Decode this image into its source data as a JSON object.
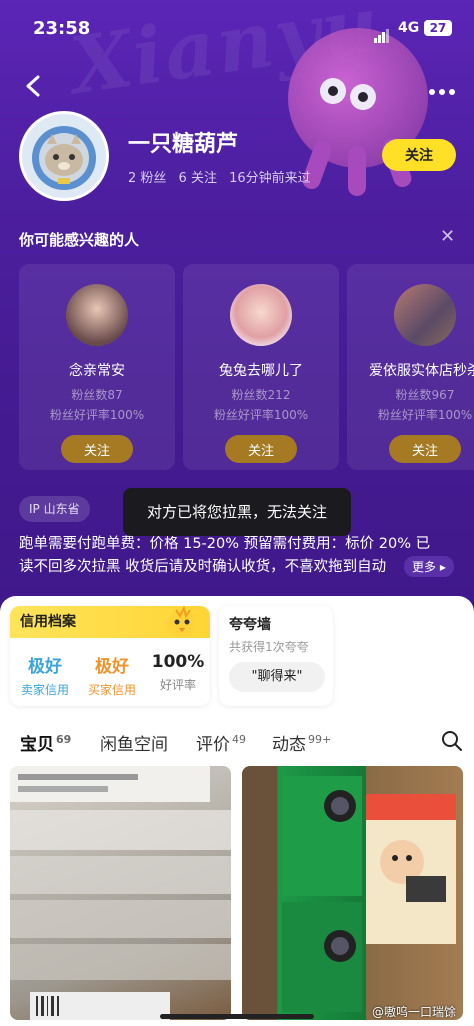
{
  "status_bar": {
    "time": "23:58",
    "network": "4G",
    "battery": "27"
  },
  "profile": {
    "nickname": "一只糖葫芦",
    "fans": "2 粉丝",
    "following": "6 关注",
    "last_seen": "16分钟前来过",
    "follow_label": "关注"
  },
  "recommend": {
    "title": "你可能感兴趣的人",
    "cards": [
      {
        "name": "念亲常安",
        "fans": "粉丝数87",
        "rate": "粉丝好评率100%",
        "button": "关注"
      },
      {
        "name": "兔兔去哪儿了",
        "fans": "粉丝数212",
        "rate": "粉丝好评率100%",
        "button": "关注"
      },
      {
        "name": "爱依服实体店秒杀",
        "fans": "粉丝数967",
        "rate": "粉丝好评率100%",
        "button": "关注"
      }
    ]
  },
  "ip": "IP 山东省",
  "toast": "对方已将您拉黑，无法关注",
  "bio": {
    "line1": "跑单需要付跑单费：价格 15-20% 预留需付费用：标价 20% 已",
    "line2": "读不回多次拉黑 收货后请及时确认收货，不喜欢拖到自动",
    "more": "更多"
  },
  "credit": {
    "title": "信用档案",
    "items": [
      {
        "value": "极好",
        "label": "卖家信用",
        "color": "#3aa6d8"
      },
      {
        "value": "极好",
        "label": "买家信用",
        "color": "#f0922a"
      },
      {
        "value": "100%",
        "label": "好评率",
        "color": "#222222"
      }
    ]
  },
  "praise": {
    "title": "夸夸墙",
    "subtitle": "共获得1次夸夸",
    "tag": "\"聊得来\""
  },
  "tabs": [
    {
      "label": "宝贝",
      "count": "69"
    },
    {
      "label": "闲鱼空间",
      "count": ""
    },
    {
      "label": "评价",
      "count": "49"
    },
    {
      "label": "动态",
      "count": "99+"
    }
  ],
  "watermark": "@嗷呜一口瑞馀",
  "bg_text": "Xianyu",
  "colors": {
    "header": "#4d1fa0",
    "accent": "#ffe027",
    "follow_card_btn": "#a57a23"
  }
}
